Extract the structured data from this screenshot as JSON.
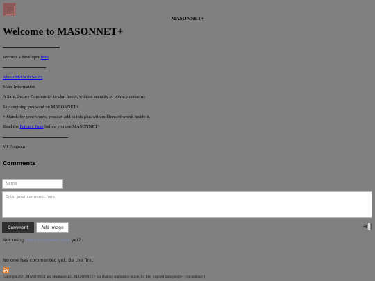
{
  "header": {
    "site_title": "MASONNET+",
    "page_heading": "Welcome to MASONNET+"
  },
  "content": {
    "become_dev_text": "Become a developer ",
    "become_dev_link": "here",
    "about_link": "About MASONNET+",
    "more_info": "More Information",
    "line1": "A Safe, Secure Community to chat freely, without security or privacy concerns",
    "line2": "Say anything you want on MASONNET+",
    "line3": "+ Stands for your words, you can add to this plus with millions of words inside it.",
    "privacy_prefix": "Read the ",
    "privacy_link": "Privacy Page",
    "privacy_suffix": " before you use MASONNET+",
    "program": "V1 Program"
  },
  "comments": {
    "heading": "Comments",
    "name_placeholder": "Name",
    "comment_placeholder": "Enter your comment here",
    "comment_button": "Comment",
    "add_image_button": "Add Image",
    "not_using_prefix": "Not using ",
    "not_using_link": "Html Comment Box",
    "not_using_suffix": " yet?",
    "empty_message": "No one has commented yet. Be the first!"
  },
  "footer": {
    "copyright": "Copyright 2021, MASONNET and newmason123. MASONNET+ is a chatting application online, for free, inspired from google+ (discontinued)"
  },
  "icons": {
    "logo": "logo-icon",
    "login": "login-icon",
    "rss": "rss-icon"
  },
  "colors": {
    "background": "#808080",
    "link": "#0000ee",
    "comment_button": "#2f2f2f",
    "rss": "#e07a2a"
  }
}
